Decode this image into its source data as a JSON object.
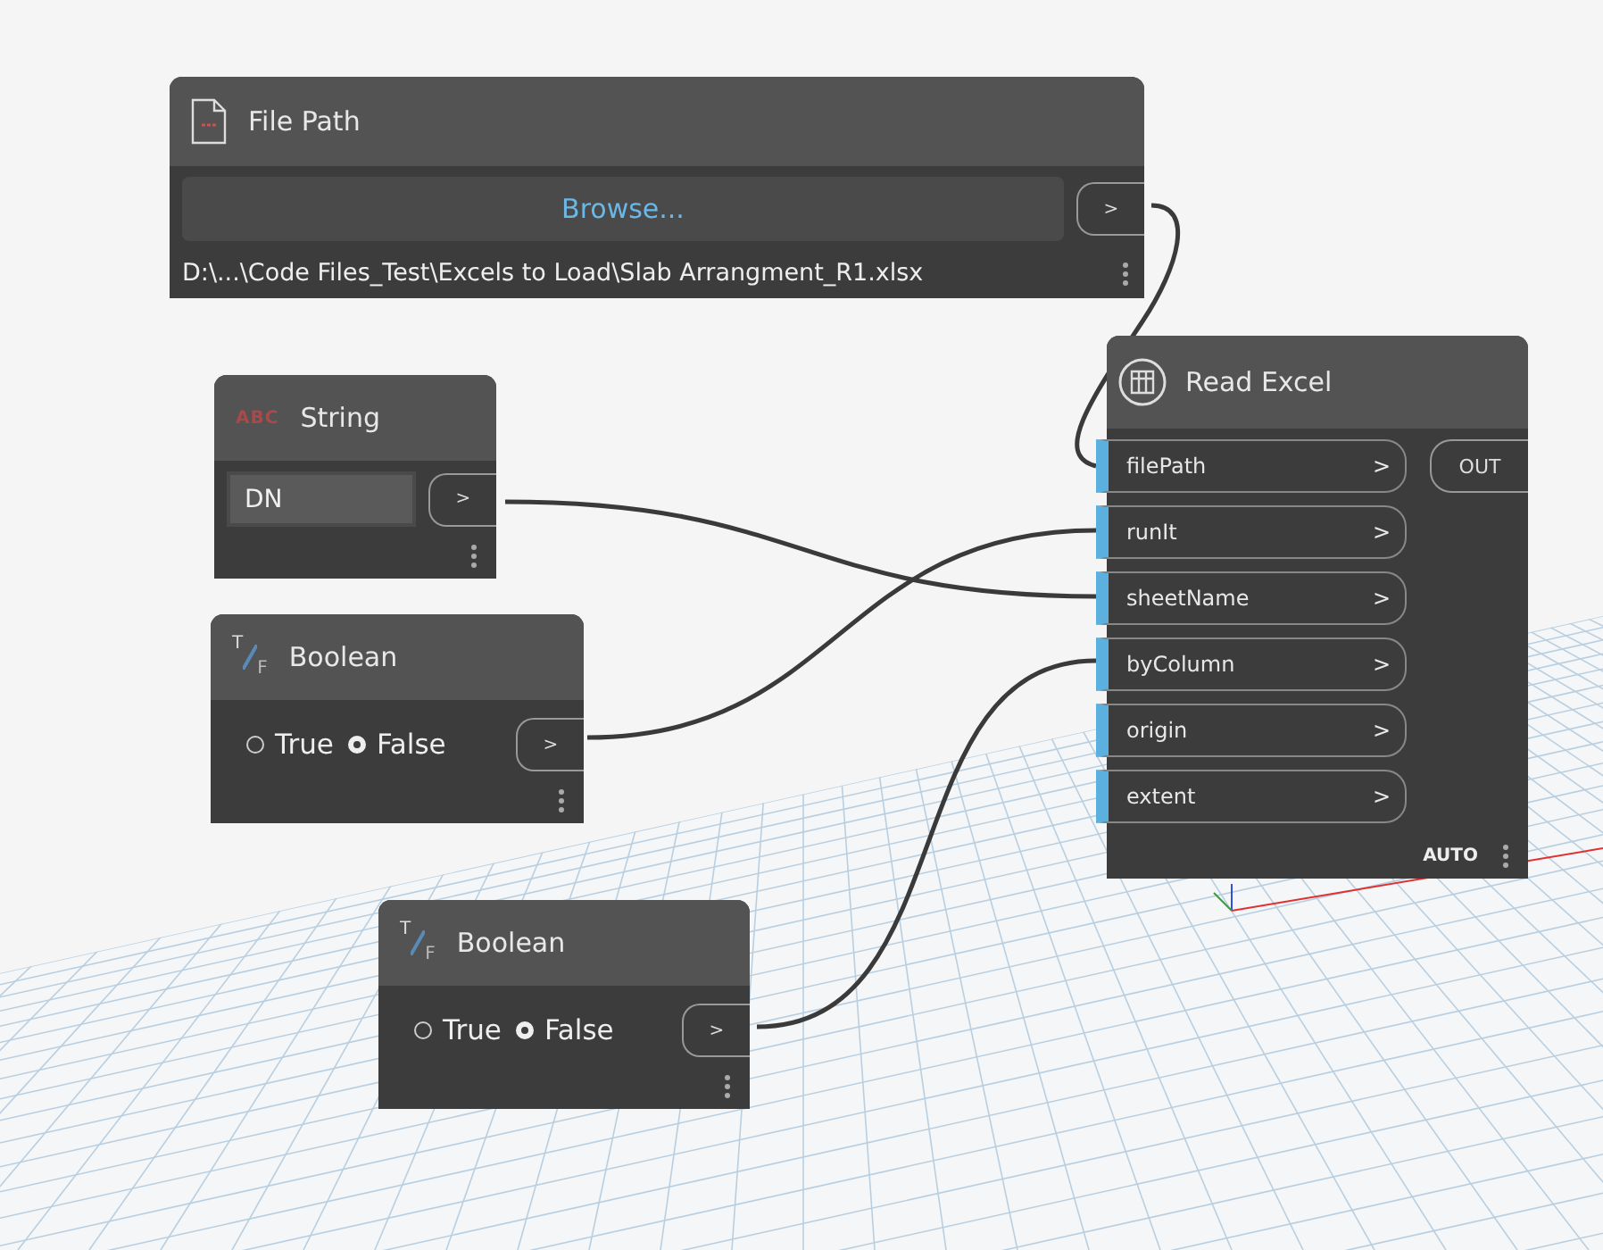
{
  "nodes": [
    {
      "kind": "filepath",
      "title": "File Path",
      "button": "Browse...",
      "port": ">",
      "path": "D:\\...\\Code Files_Test\\Excels to Load\\Slab Arrangment_R1.xlsx"
    },
    {
      "kind": "string",
      "icon_text": "ABC",
      "title": "String",
      "value": "DN",
      "port": ">"
    },
    {
      "kind": "boolean",
      "icon_letters": [
        "T",
        "F"
      ],
      "title": "Boolean",
      "options": [
        {
          "label": "True",
          "selected": false
        },
        {
          "label": "False",
          "selected": true
        }
      ],
      "port": ">"
    },
    {
      "kind": "function",
      "title": "Read Excel",
      "inputs": [
        {
          "name": "filePath",
          "port": ">"
        },
        {
          "name": "runIt",
          "port": ">"
        },
        {
          "name": "sheetName",
          "port": ">"
        },
        {
          "name": "byColumn",
          "port": ">"
        },
        {
          "name": "origin",
          "port": ">"
        },
        {
          "name": "extent",
          "port": ">"
        }
      ],
      "output": "OUT",
      "mode": "AUTO"
    },
    {
      "kind": "boolean",
      "icon_letters": [
        "T",
        "F"
      ],
      "title": "Boolean",
      "options": [
        {
          "label": "True",
          "selected": false
        },
        {
          "label": "False",
          "selected": true
        }
      ],
      "port": ">"
    }
  ]
}
